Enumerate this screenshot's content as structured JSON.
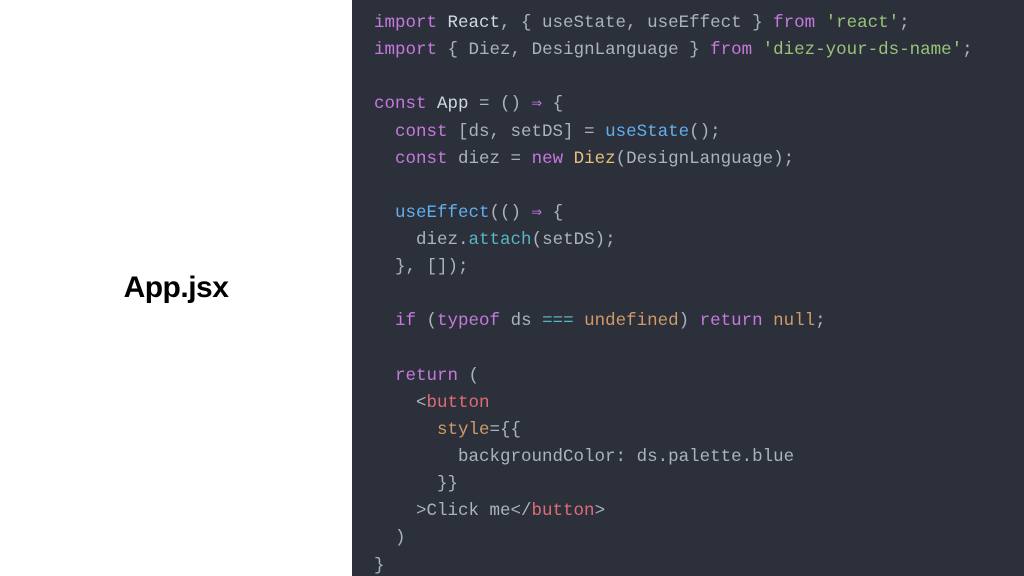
{
  "left": {
    "filename": "App.jsx"
  },
  "code": {
    "lines": [
      [
        {
          "t": "import ",
          "c": "tok-kw"
        },
        {
          "t": "React",
          "c": "tok-def"
        },
        {
          "t": ", { ",
          "c": "tok-punct"
        },
        {
          "t": "useState",
          "c": "tok-id"
        },
        {
          "t": ", ",
          "c": "tok-punct"
        },
        {
          "t": "useEffect",
          "c": "tok-id"
        },
        {
          "t": " } ",
          "c": "tok-punct"
        },
        {
          "t": "from ",
          "c": "tok-kw"
        },
        {
          "t": "'react'",
          "c": "tok-str"
        },
        {
          "t": ";",
          "c": "tok-punct"
        }
      ],
      [
        {
          "t": "import ",
          "c": "tok-kw"
        },
        {
          "t": "{ ",
          "c": "tok-punct"
        },
        {
          "t": "Diez",
          "c": "tok-id"
        },
        {
          "t": ", ",
          "c": "tok-punct"
        },
        {
          "t": "DesignLanguage",
          "c": "tok-id"
        },
        {
          "t": " } ",
          "c": "tok-punct"
        },
        {
          "t": "from ",
          "c": "tok-kw"
        },
        {
          "t": "'diez-your-ds-name'",
          "c": "tok-str"
        },
        {
          "t": ";",
          "c": "tok-punct"
        }
      ],
      [
        {
          "t": " ",
          "c": "tok-punct"
        }
      ],
      [
        {
          "t": "const ",
          "c": "tok-kw"
        },
        {
          "t": "App",
          "c": "tok-def"
        },
        {
          "t": " = () ",
          "c": "tok-punct"
        },
        {
          "t": "⇒",
          "c": "tok-kw"
        },
        {
          "t": " {",
          "c": "tok-punct"
        }
      ],
      [
        {
          "t": "  ",
          "c": "tok-punct"
        },
        {
          "t": "const ",
          "c": "tok-kw"
        },
        {
          "t": "[ds, setDS] = ",
          "c": "tok-punct"
        },
        {
          "t": "useState",
          "c": "tok-fn"
        },
        {
          "t": "();",
          "c": "tok-punct"
        }
      ],
      [
        {
          "t": "  ",
          "c": "tok-punct"
        },
        {
          "t": "const ",
          "c": "tok-kw"
        },
        {
          "t": "diez",
          "c": "tok-id"
        },
        {
          "t": " = ",
          "c": "tok-punct"
        },
        {
          "t": "new ",
          "c": "tok-kw"
        },
        {
          "t": "Diez",
          "c": "tok-type"
        },
        {
          "t": "(",
          "c": "tok-punct"
        },
        {
          "t": "DesignLanguage",
          "c": "tok-id"
        },
        {
          "t": ");",
          "c": "tok-punct"
        }
      ],
      [
        {
          "t": " ",
          "c": "tok-punct"
        }
      ],
      [
        {
          "t": "  ",
          "c": "tok-punct"
        },
        {
          "t": "useEffect",
          "c": "tok-fn"
        },
        {
          "t": "(() ",
          "c": "tok-punct"
        },
        {
          "t": "⇒",
          "c": "tok-kw"
        },
        {
          "t": " {",
          "c": "tok-punct"
        }
      ],
      [
        {
          "t": "    ",
          "c": "tok-punct"
        },
        {
          "t": "diez",
          "c": "tok-id"
        },
        {
          "t": ".",
          "c": "tok-punct"
        },
        {
          "t": "attach",
          "c": "tok-prop"
        },
        {
          "t": "(",
          "c": "tok-punct"
        },
        {
          "t": "setDS",
          "c": "tok-id"
        },
        {
          "t": ");",
          "c": "tok-punct"
        }
      ],
      [
        {
          "t": "  }, []);",
          "c": "tok-punct"
        }
      ],
      [
        {
          "t": " ",
          "c": "tok-punct"
        }
      ],
      [
        {
          "t": "  ",
          "c": "tok-punct"
        },
        {
          "t": "if ",
          "c": "tok-kw"
        },
        {
          "t": "(",
          "c": "tok-punct"
        },
        {
          "t": "typeof ",
          "c": "tok-kw"
        },
        {
          "t": "ds ",
          "c": "tok-id"
        },
        {
          "t": "===",
          "c": "tok-op"
        },
        {
          "t": " ",
          "c": "tok-punct"
        },
        {
          "t": "undefined",
          "c": "tok-undef"
        },
        {
          "t": ") ",
          "c": "tok-punct"
        },
        {
          "t": "return ",
          "c": "tok-kw"
        },
        {
          "t": "null",
          "c": "tok-null"
        },
        {
          "t": ";",
          "c": "tok-punct"
        }
      ],
      [
        {
          "t": " ",
          "c": "tok-punct"
        }
      ],
      [
        {
          "t": "  ",
          "c": "tok-punct"
        },
        {
          "t": "return ",
          "c": "tok-kw"
        },
        {
          "t": "(",
          "c": "tok-punct"
        }
      ],
      [
        {
          "t": "    <",
          "c": "tok-punct"
        },
        {
          "t": "button",
          "c": "tok-tag"
        }
      ],
      [
        {
          "t": "      ",
          "c": "tok-punct"
        },
        {
          "t": "style",
          "c": "tok-attr"
        },
        {
          "t": "={{",
          "c": "tok-punct"
        }
      ],
      [
        {
          "t": "        ",
          "c": "tok-punct"
        },
        {
          "t": "backgroundColor",
          "c": "tok-id"
        },
        {
          "t": ": ",
          "c": "tok-punct"
        },
        {
          "t": "ds",
          "c": "tok-id"
        },
        {
          "t": ".",
          "c": "tok-punct"
        },
        {
          "t": "palette",
          "c": "tok-id"
        },
        {
          "t": ".",
          "c": "tok-punct"
        },
        {
          "t": "blue",
          "c": "tok-id"
        }
      ],
      [
        {
          "t": "      }}",
          "c": "tok-punct"
        }
      ],
      [
        {
          "t": "    >",
          "c": "tok-punct"
        },
        {
          "t": "Click me",
          "c": "tok-id"
        },
        {
          "t": "</",
          "c": "tok-punct"
        },
        {
          "t": "button",
          "c": "tok-tag"
        },
        {
          "t": ">",
          "c": "tok-punct"
        }
      ],
      [
        {
          "t": "  )",
          "c": "tok-punct"
        }
      ],
      [
        {
          "t": "}",
          "c": "tok-punct"
        }
      ]
    ]
  }
}
